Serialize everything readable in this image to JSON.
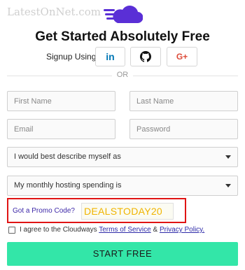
{
  "watermark": "LatestOnNet.com",
  "title": "Get Started Absolutely Free",
  "signup": {
    "label": "Signup Using",
    "providers": [
      {
        "name": "LinkedIn",
        "glyph": "in",
        "icon": "linkedin-icon",
        "color": "#0077b5"
      },
      {
        "name": "GitHub",
        "icon": "github-icon",
        "color": "#111111"
      },
      {
        "name": "Google+",
        "glyph": "G+",
        "icon": "google-plus-icon",
        "color": "#dd4b39"
      }
    ]
  },
  "or_text": "OR",
  "form": {
    "first_name_placeholder": "First Name",
    "last_name_placeholder": "Last Name",
    "email_placeholder": "Email",
    "password_placeholder": "Password",
    "describe_select": "I would best describe myself as",
    "spending_select": "My monthly hosting spending is"
  },
  "promo": {
    "label": "Got a Promo Code?",
    "code": "DEALSTODAY20",
    "highlight_color": "#e01414"
  },
  "agree": {
    "text": "I agree to the Cloudways",
    "terms_link": "Terms of Service",
    "amp": "&",
    "privacy_link": "Privacy Policy."
  },
  "start_button": "START FREE",
  "colors": {
    "brand": "#5a2fd6",
    "start_button": "#33e6a8",
    "link": "#2d2aa8"
  }
}
